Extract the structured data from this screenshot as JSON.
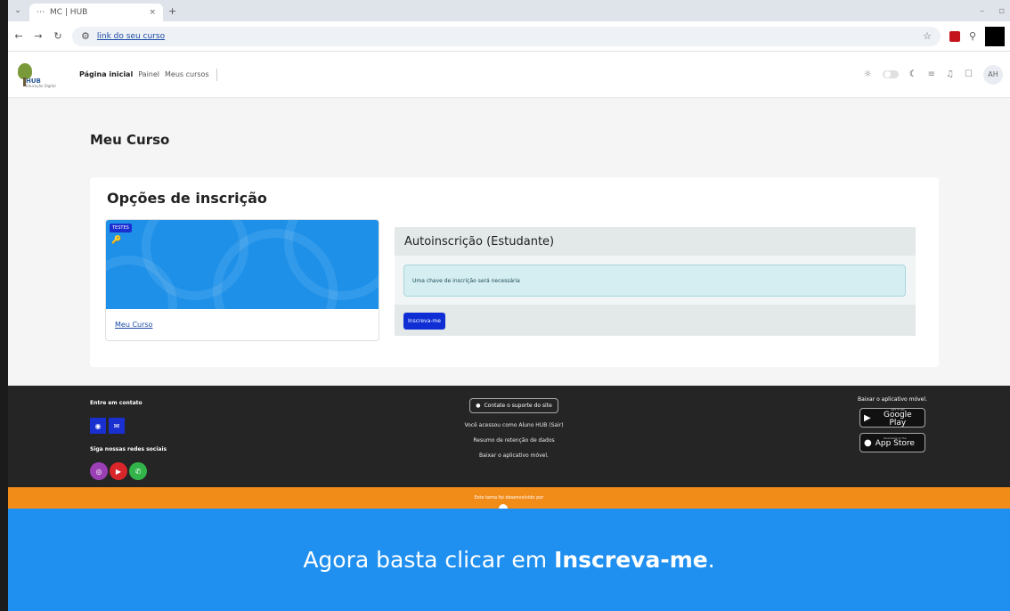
{
  "browser": {
    "tab_title": "MC | HUB",
    "tab_close": "×",
    "new_tab": "+",
    "url": "link do seu curso",
    "star": "☆"
  },
  "header": {
    "logo_text": "HUB",
    "logo_sub": "Educação Digital",
    "nav": [
      {
        "label": "Página inicial",
        "active": true
      },
      {
        "label": "Painel",
        "active": false
      },
      {
        "label": "Meus cursos",
        "active": false
      }
    ],
    "avatar_initials": "AH"
  },
  "page": {
    "title": "Meu Curso",
    "card_title": "Opções de inscrição",
    "course": {
      "badge": "TESTES",
      "link": "Meu Curso"
    },
    "enrol": {
      "title": "Autoinscrição (Estudante)",
      "notice": "Uma chave de inscrição será necessária",
      "button": "Inscreva-me"
    }
  },
  "footer": {
    "contact_title": "Entre em contato",
    "social_title": "Siga nossas redes sociais",
    "support_button": "Contate o suporte do site",
    "logged_in": "Você acessou como Aluno HUB (Sair)",
    "data_retention": "Resumo de retenção de dados",
    "get_app_center": "Baixar o aplicativo móvel.",
    "get_app_right": "Baixar o aplicativo móvel.",
    "google_play_small": "GET IT ON",
    "google_play": "Google Play",
    "app_store_small": "Download on the",
    "app_store": "App Store",
    "theme_credit": "Este tema foi desenvolvido por"
  },
  "caption": {
    "prefix": "Agora basta clicar em",
    "bold": "Inscreva-me",
    "suffix": "."
  },
  "colors": {
    "footer_bg": "#252525",
    "orange": "#f28c19",
    "caption_bg": "#1f8ff0",
    "primary_button": "#0f2fd5"
  }
}
